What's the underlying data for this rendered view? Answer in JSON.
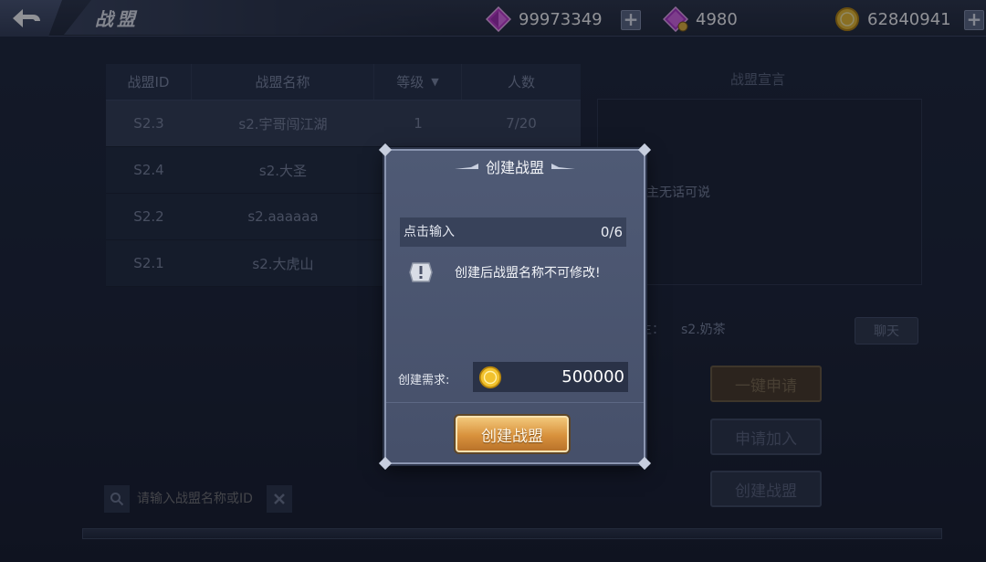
{
  "header": {
    "title": "战盟",
    "resources": [
      {
        "name": "pink-gem",
        "value": "99973349",
        "color": "#d045d8"
      },
      {
        "name": "bound-gem",
        "value": "4980",
        "color": "#c043d6"
      },
      {
        "name": "gold-coin",
        "value": "62840941",
        "color": "#f0c030"
      }
    ]
  },
  "table": {
    "columns": [
      "战盟ID",
      "战盟名称",
      "等级",
      "人数"
    ],
    "rows": [
      {
        "id": "S2.3",
        "name": "s2.宇哥闯江湖",
        "level": "1",
        "members": "7/20"
      },
      {
        "id": "S2.4",
        "name": "s2.大圣",
        "level": "",
        "members": ""
      },
      {
        "id": "S2.2",
        "name": "s2.aaaaaa",
        "level": "",
        "members": ""
      },
      {
        "id": "S2.1",
        "name": "s2.大虎山",
        "level": "",
        "members": ""
      }
    ]
  },
  "search": {
    "placeholder": "请输入战盟名称或ID"
  },
  "right_panel": {
    "declaration_title": "战盟宣言",
    "declaration_text": "盟主无话可说",
    "leader_label": "主：",
    "leader_name": "s2.奶茶",
    "chat_label": "聊天",
    "buttons": {
      "one_click_apply": "一键申请",
      "apply_join": "申请加入",
      "create": "创建战盟"
    }
  },
  "modal": {
    "title": "创建战盟",
    "input_placeholder": "点击输入",
    "char_count": "0/6",
    "warning": "创建后战盟名称不可修改!",
    "requirement_label": "创建需求:",
    "requirement_value": "500000",
    "confirm_label": "创建战盟"
  }
}
